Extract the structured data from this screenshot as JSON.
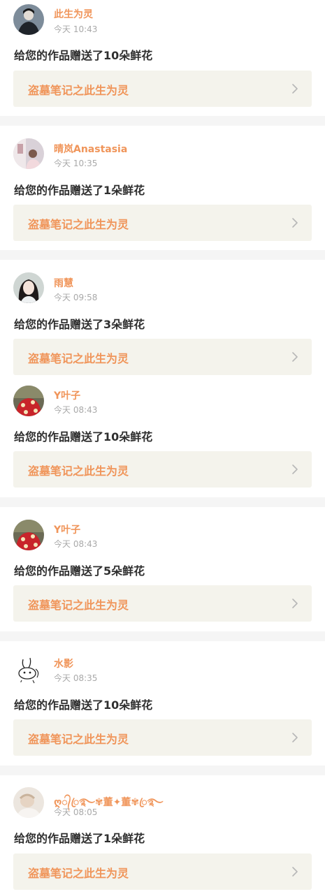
{
  "notifications": [
    {
      "username": "此生为灵",
      "time": "今天 10:43",
      "message": "给您的作品赠送了10朵鲜花",
      "work_title": "盗墓笔记之此生为灵",
      "avatar_icon": "dark-portrait-avatar"
    },
    {
      "username": "晴岚Anastasia",
      "time": "今天 10:35",
      "message": "给您的作品赠送了1朵鲜花",
      "work_title": "盗墓笔记之此生为灵",
      "avatar_icon": "room-photo-avatar"
    },
    {
      "username": "雨慧",
      "time": "今天 09:58",
      "message": "给您的作品赠送了3朵鲜花",
      "work_title": "盗墓笔记之此生为灵",
      "avatar_icon": "girl-portrait-avatar"
    },
    {
      "username": "Y叶子",
      "time": "今天 08:43",
      "message": "给您的作品赠送了10朵鲜花",
      "work_title": "盗墓笔记之此生为灵",
      "avatar_icon": "red-polka-avatar"
    },
    {
      "username": "Y叶子",
      "time": "今天 08:43",
      "message": "给您的作品赠送了5朵鲜花",
      "work_title": "盗墓笔记之此生为灵",
      "avatar_icon": "red-polka-avatar"
    },
    {
      "username": "水影",
      "time": "今天 08:35",
      "message": "给您的作品赠送了10朵鲜花",
      "work_title": "盗墓笔记之此生为灵",
      "avatar_icon": "sketch-bunny-avatar"
    },
    {
      "username": "ღ᭄ꦿ࿐✾董✦董✾ꦿ࿐",
      "time": "今天 08:05",
      "message": "给您的作品赠送了1朵鲜花",
      "work_title": "盗墓笔记之此生为灵",
      "avatar_icon": "soft-photo-avatar"
    }
  ],
  "colors": {
    "accent": "#f0955a",
    "text": "#2f2f2f",
    "muted": "#a9a9a9",
    "work_bg": "#f4f3ec",
    "separator": "#f5f5f5"
  }
}
